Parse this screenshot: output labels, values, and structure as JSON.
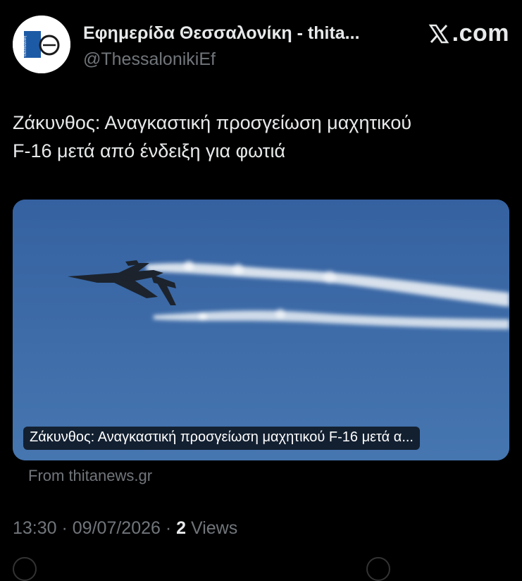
{
  "account": {
    "name": "Εφημερίδα Θεσσαλονίκη - thita...",
    "handle": "@ThessalonikiEf",
    "avatar_icon": "thessaloniki-newspaper-logo"
  },
  "brand": {
    "logo_text": ".com",
    "logo_icon": "x-logo-icon"
  },
  "tweet": {
    "text_line1": "Ζάκυνθος: Αναγκαστική προσγείωση μαχητικού",
    "text_line2": "F-16 μετά από ένδειξη για φωτιά"
  },
  "card": {
    "title": "Ζάκυνθος: Αναγκαστική προσγείωση μαχητικού F-16 μετά α...",
    "source": "From thitanews.gr",
    "image_subject": "fighter-jet-with-smoke-trails"
  },
  "meta": {
    "time": "13:30",
    "sep1": " · ",
    "date": "09/07/2026",
    "sep2": " · ",
    "views_count": "2",
    "views_label": " Views"
  },
  "colors": {
    "background": "#000000",
    "text_primary": "#e7e9ea",
    "text_secondary": "#71767b",
    "sky": "#3b689e"
  }
}
